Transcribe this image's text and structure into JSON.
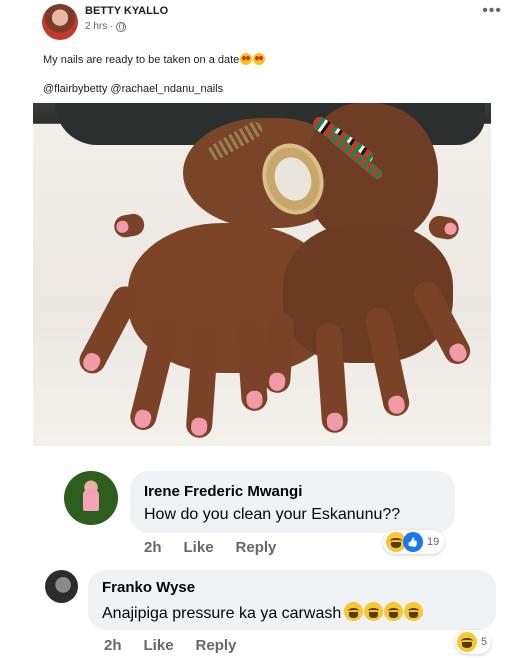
{
  "post": {
    "author": "BETTY KYALLO",
    "time": "2 hrs ·",
    "caption": "My nails are ready to be taken on a date",
    "tags": "@flairbybetty @rachael_ndanu_nails",
    "more_label": "•••"
  },
  "comments": [
    {
      "name": "Irene Frederic Mwangi",
      "text": "How do you clean your Eskanunu??",
      "time": "2h",
      "like_label": "Like",
      "reply_label": "Reply",
      "reaction_count": "19",
      "reaction_icons": [
        "laugh-emoji",
        "like-emoji"
      ]
    },
    {
      "name": "Franko Wyse",
      "text": "Anajipiga pressure ka ya carwash",
      "time": "2h",
      "like_label": "Like",
      "reply_label": "Reply",
      "reaction_count": "5",
      "reaction_icons": [
        "laugh-emoji"
      ],
      "inline_emojis": [
        "laugh-emoji",
        "laugh-emoji",
        "laugh-emoji",
        "laugh-emoji"
      ]
    }
  ],
  "colors": {
    "bubble": "#f0f2f5",
    "meta_text": "#65676b",
    "like_blue": "#1877f2",
    "nail_pink": "#f29aa8"
  }
}
